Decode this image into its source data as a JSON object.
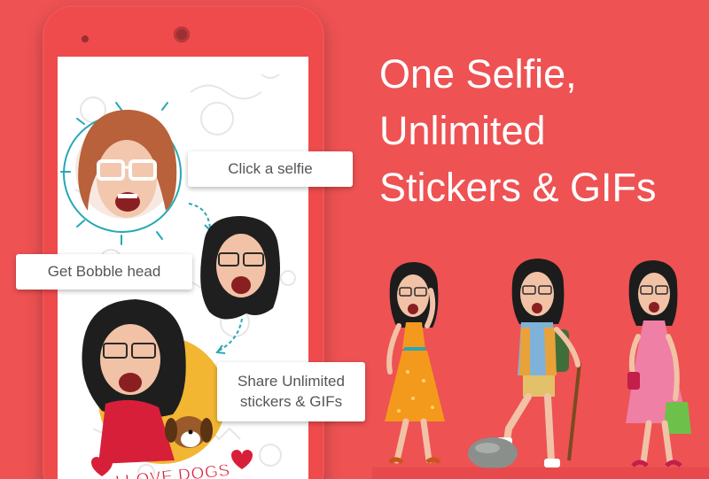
{
  "headline": {
    "line1": "One Selfie,",
    "line2": "Unlimited",
    "line3": "Stickers & GIFs"
  },
  "steps": {
    "selfie": "Click a selfie",
    "bobble": "Get Bobble head",
    "share_line1": "Share Unlimited",
    "share_line2": "stickers & GIFs"
  },
  "sticker": {
    "text": "I LOVE DOGS"
  },
  "colors": {
    "background": "#ee5253",
    "phone": "#ef4a4c",
    "accent_teal": "#27a7b5",
    "sticker_yellow": "#f2b632",
    "sticker_red": "#d81f3a"
  },
  "icons": [
    "phone-camera-icon",
    "arrow-icon",
    "heart-icon"
  ]
}
